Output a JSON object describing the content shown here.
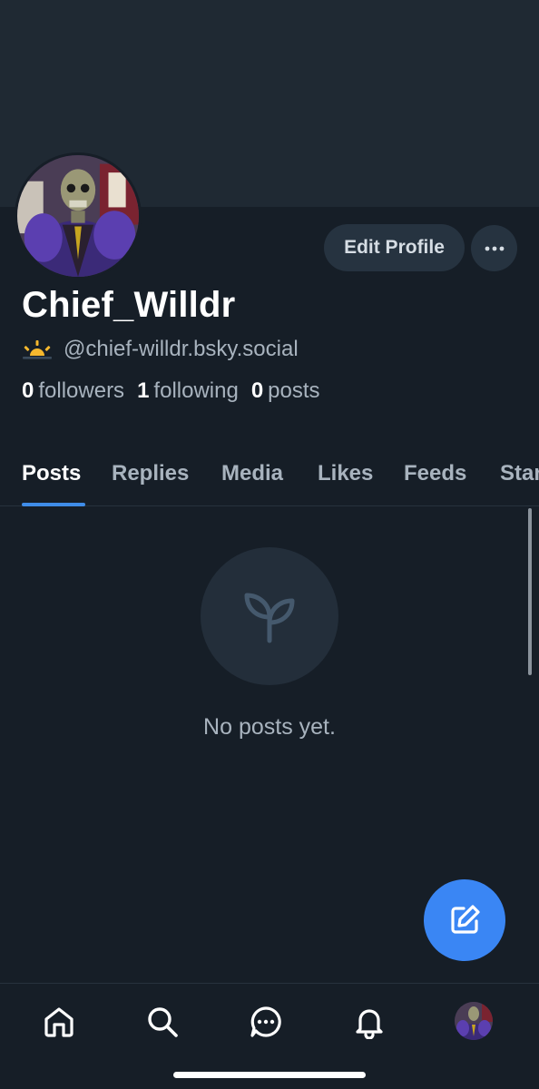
{
  "profile": {
    "display_name": "Chief_Willdr",
    "handle": "@chief-willdr.bsky.social",
    "handle_icon": "sunrise-emoji-icon",
    "stats": {
      "followers_count": "0",
      "followers_label": "followers",
      "following_count": "1",
      "following_label": "following",
      "posts_count": "0",
      "posts_label": "posts"
    }
  },
  "actions": {
    "edit_profile_label": "Edit Profile",
    "more_icon": "ellipsis-icon"
  },
  "tabs": [
    {
      "label": "Posts",
      "active": true
    },
    {
      "label": "Replies",
      "active": false
    },
    {
      "label": "Media",
      "active": false
    },
    {
      "label": "Likes",
      "active": false
    },
    {
      "label": "Feeds",
      "active": false
    },
    {
      "label": "Starter Packs",
      "active": false
    }
  ],
  "empty_state": {
    "icon": "seedling-icon",
    "text": "No posts yet."
  },
  "fab": {
    "icon": "compose-icon"
  },
  "bottom_nav": [
    {
      "name": "home",
      "icon": "home-icon"
    },
    {
      "name": "search",
      "icon": "search-icon"
    },
    {
      "name": "chat",
      "icon": "chat-icon"
    },
    {
      "name": "notifications",
      "icon": "bell-icon"
    },
    {
      "name": "profile",
      "icon": "avatar"
    }
  ],
  "colors": {
    "background": "#161e27",
    "banner": "#1f2933",
    "accent": "#3f8de8",
    "fab": "#3a86f4",
    "muted_text": "#a8b3be",
    "button_bg": "#263340"
  }
}
